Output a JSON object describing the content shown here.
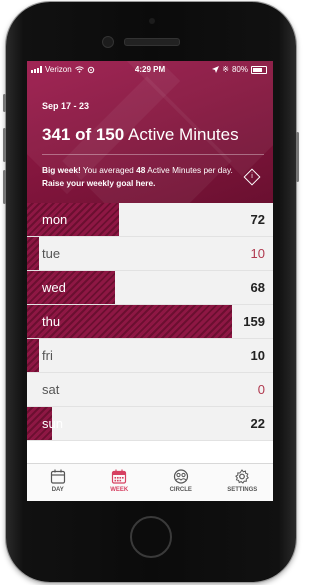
{
  "status_bar": {
    "carrier": "Verizon",
    "time": "4:29 PM",
    "battery_percent": "80%",
    "signal_bars": 3
  },
  "summary": {
    "date_range": "Sep 17 - 23",
    "minutes_count": "341 of 150",
    "minutes_label": "Active Minutes",
    "message_bold_1": "Big week!",
    "message_text_1": " You averaged ",
    "message_bold_2": "48",
    "message_text_2": " Active Minutes per day. ",
    "message_link": "Raise your weekly goal here.",
    "info_icon": "i"
  },
  "days": [
    {
      "day": "mon",
      "value": "72",
      "fraction": 0.45,
      "highlight": true
    },
    {
      "day": "tue",
      "value": "10",
      "fraction": 0.05,
      "highlight": false
    },
    {
      "day": "wed",
      "value": "68",
      "fraction": 0.43,
      "highlight": true
    },
    {
      "day": "thu",
      "value": "159",
      "fraction": 1.0,
      "highlight": true
    },
    {
      "day": "fri",
      "value": "10",
      "fraction": 0.05,
      "highlight": false
    },
    {
      "day": "sat",
      "value": "0",
      "fraction": 0.0,
      "highlight": false
    },
    {
      "day": "sun",
      "value": "22",
      "fraction": 0.12,
      "highlight": true
    }
  ],
  "tabs": [
    {
      "label": "DAY",
      "icon": "calendar-icon",
      "active": false
    },
    {
      "label": "WEEK",
      "icon": "week-calendar-icon",
      "active": true
    },
    {
      "label": "CIRCLE",
      "icon": "circle-group-icon",
      "active": false
    },
    {
      "label": "SETTINGS",
      "icon": "gear-icon",
      "active": false
    }
  ],
  "colors": {
    "brand": "#8e1744",
    "active_tab": "#d64061"
  }
}
